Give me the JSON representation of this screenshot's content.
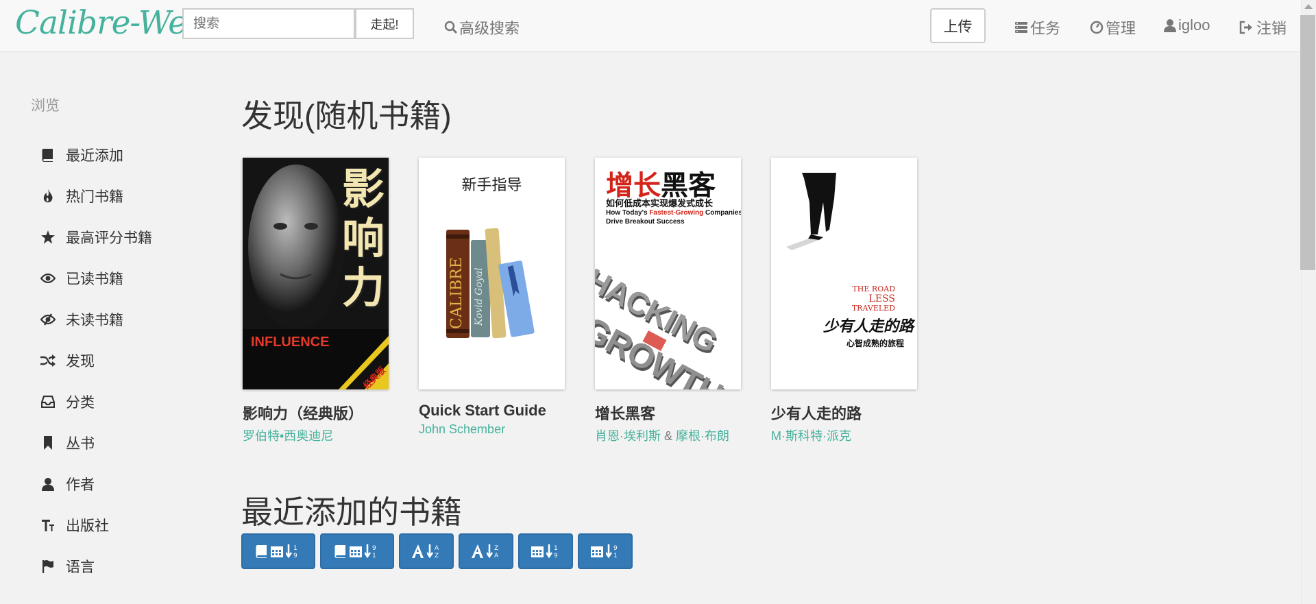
{
  "brand": "Calibre-Web",
  "search": {
    "placeholder": "搜索",
    "go_label": "走起!"
  },
  "nav": {
    "advanced_search": "高级搜索",
    "upload": "上传",
    "tasks": "任务",
    "admin": "管理",
    "user": "igloo",
    "logout": "注销"
  },
  "sidebar": {
    "heading": "浏览",
    "items": [
      {
        "label": "最近添加",
        "icon": "book-icon"
      },
      {
        "label": "热门书籍",
        "icon": "fire-icon"
      },
      {
        "label": "最高评分书籍",
        "icon": "star-icon"
      },
      {
        "label": "已读书籍",
        "icon": "eye-icon"
      },
      {
        "label": "未读书籍",
        "icon": "eye-slash-icon"
      },
      {
        "label": "发现",
        "icon": "random-icon"
      },
      {
        "label": "分类",
        "icon": "inbox-icon"
      },
      {
        "label": "丛书",
        "icon": "bookmark-icon"
      },
      {
        "label": "作者",
        "icon": "user-icon"
      },
      {
        "label": "出版社",
        "icon": "text-size-icon"
      },
      {
        "label": "语言",
        "icon": "flag-icon"
      }
    ]
  },
  "discover": {
    "title": "发现(随机书籍)",
    "books": [
      {
        "title": "影响力（经典版）",
        "authors": [
          "罗伯特•西奥迪尼"
        ],
        "cover": {
          "big_text": [
            "影",
            "响",
            "力"
          ],
          "sub": "INFLUENCE",
          "badge": "经典版"
        }
      },
      {
        "title": "Quick Start Guide",
        "authors": [
          "John Schember"
        ],
        "cover": {
          "heading": "新手指导",
          "spine1": "CALIBRE",
          "spine2": "Kovid Goyal"
        }
      },
      {
        "title": "增长黑客",
        "authors": [
          "肖恩·埃利斯",
          "摩根·布朗"
        ],
        "author_sep": "&",
        "cover": {
          "heading_red": "增长",
          "heading_black": "黑客",
          "subtitle": "如何低成本实现爆发式成长",
          "eng_line1": "How Today's",
          "eng_red": "Fastest-Growing",
          "eng_line1b": "Companies",
          "eng_line2": "Drive Breakout Success",
          "word1": "HACKING",
          "word2": "GROWTH"
        }
      },
      {
        "title": "少有人走的路",
        "authors": [
          "M·斯科特·派克"
        ],
        "cover": {
          "eng": [
            "THE ROAD",
            "LESS",
            "TRAVELED"
          ],
          "cn_title": "少有人走的路",
          "cn_sub": "心智成熟的旅程"
        }
      }
    ]
  },
  "recent": {
    "title": "最近添加的书籍"
  },
  "sort_buttons": [
    {
      "name": "sort-added-new",
      "icons": [
        "book",
        "calendar",
        "sort-num-desc"
      ]
    },
    {
      "name": "sort-added-old",
      "icons": [
        "book",
        "calendar",
        "sort-num-asc"
      ]
    },
    {
      "name": "sort-title-az",
      "icons": [
        "font",
        "sort-alpha-asc"
      ]
    },
    {
      "name": "sort-title-za",
      "icons": [
        "font",
        "sort-alpha-desc"
      ]
    },
    {
      "name": "sort-pubdate-new",
      "icons": [
        "calendar",
        "sort-num-desc"
      ]
    },
    {
      "name": "sort-pubdate-old",
      "icons": [
        "calendar",
        "sort-num-asc"
      ]
    }
  ],
  "colors": {
    "accent": "#45b29d",
    "primary": "#337ab7",
    "background": "#f2f2f2"
  }
}
